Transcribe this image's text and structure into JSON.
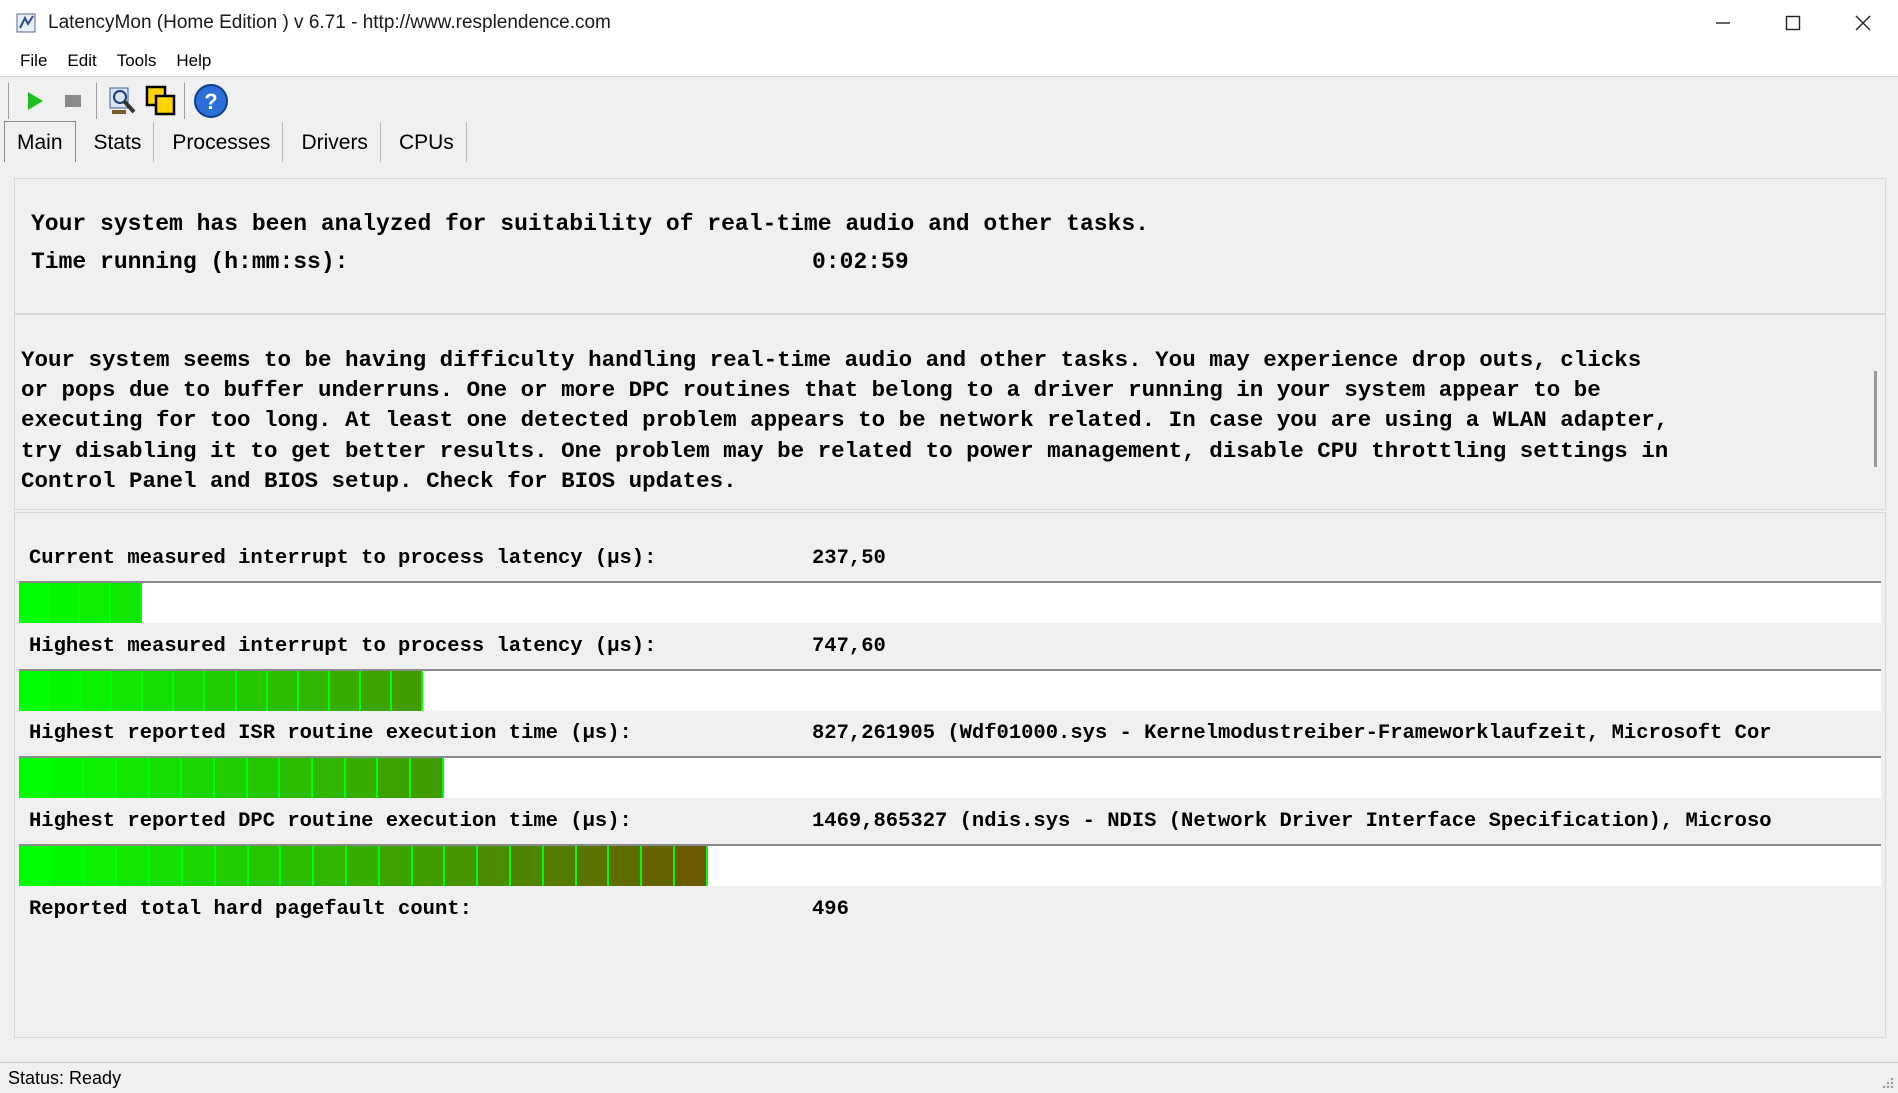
{
  "window": {
    "title": "LatencyMon  (Home Edition )  v 6.71 - http://www.resplendence.com"
  },
  "menu": [
    "File",
    "Edit",
    "Tools",
    "Help"
  ],
  "toolbar": {
    "icons": [
      "play-icon",
      "stop-icon",
      "analyze-icon",
      "windows-icon",
      "help-icon"
    ]
  },
  "tabs": [
    "Main",
    "Stats",
    "Processes",
    "Drivers",
    "CPUs"
  ],
  "summary": {
    "line1": "Your system has been analyzed for suitability of real-time audio and other tasks.",
    "time_label": "Time running (h:mm:ss):",
    "time_value": "0:02:59"
  },
  "warning": {
    "text": "Your system seems to be having difficulty handling real-time audio and other tasks. You may experience drop outs, clicks\nor pops due to buffer underruns. One or more DPC routines that belong to a driver running in your system appear to be\nexecuting for too long. At least one detected problem appears to be network related. In case you are using a WLAN adapter,\ntry disabling it to get better results. One problem may be related to power management, disable CPU throttling settings in\nControl Panel and BIOS setup. Check for BIOS updates."
  },
  "metrics": [
    {
      "label": "Current measured interrupt to process latency (µs):",
      "value": "237,50",
      "bar_fraction": 0.066,
      "segments": 4
    },
    {
      "label": "Highest measured interrupt to process latency (µs):",
      "value": "747,60",
      "bar_fraction": 0.217,
      "segments": 13
    },
    {
      "label": "Highest reported ISR routine execution time (µs):",
      "value": "827,261905   (Wdf01000.sys - Kernelmodustreiber-Frameworklaufzeit, Microsoft Cor",
      "bar_fraction": 0.228,
      "segments": 13
    },
    {
      "label": "Highest reported DPC routine execution time (µs):",
      "value": "1469,865327   (ndis.sys - NDIS (Network Driver Interface Specification), Microso",
      "bar_fraction": 0.37,
      "segments": 21
    }
  ],
  "pagefault": {
    "label": "Reported total hard pagefault count:",
    "value": "496"
  },
  "status": {
    "text": "Status: Ready"
  },
  "colors": {
    "bar_start": "#00ff00",
    "bar_end": "#6b5a00",
    "panel_border": "#d8d8d8"
  }
}
